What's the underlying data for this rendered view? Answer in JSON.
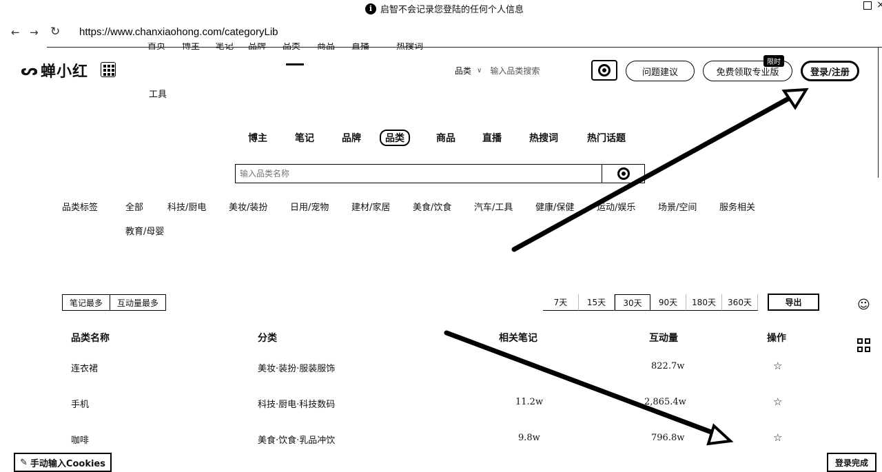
{
  "browser": {
    "banner_text": "启智不会记录您登陆的任何个人信息",
    "info_icon": "i",
    "back_glyph": "←",
    "forward_glyph": "→",
    "reload_glyph": "↻",
    "url": "https://www.chanxiaohong.com/categoryLib"
  },
  "site": {
    "top_nav_items": [
      "首页",
      "博主",
      "笔记",
      "品牌",
      "品类",
      "商品",
      "直播",
      "热搜词"
    ],
    "logo_mark": "ᔕ",
    "logo_text": "蝉小红",
    "tools_label": "工具",
    "header_search": {
      "scope": "品类",
      "chevron": "∨",
      "placeholder": "输入品类搜索"
    },
    "feedback_label": "问题建议",
    "pro_label": "免费领取专业版",
    "pro_badge": "限时",
    "login_label": "登录/注册"
  },
  "main_tabs": [
    {
      "label": "博主",
      "active": false
    },
    {
      "label": "笔记",
      "active": false
    },
    {
      "label": "品牌",
      "active": false
    },
    {
      "label": "品类",
      "active": true
    },
    {
      "label": "商品",
      "active": false
    },
    {
      "label": "直播",
      "active": false
    },
    {
      "label": "热搜词",
      "active": false
    },
    {
      "label": "热门话题",
      "active": false
    }
  ],
  "category_search": {
    "placeholder": "输入品类名称"
  },
  "category_tags": {
    "label": "品类标签",
    "items": [
      "全部",
      "科技/厨电",
      "美妆/装扮",
      "日用/宠物",
      "建材/家居",
      "美食/饮食",
      "汽车/工具",
      "健康/保健",
      "运动/娱乐",
      "场景/空间",
      "服务相关",
      "教育/母婴"
    ]
  },
  "sort_options": [
    "笔记最多",
    "互动量最多"
  ],
  "day_ranges": [
    "7天",
    "15天",
    "30天",
    "90天",
    "180天",
    "360天"
  ],
  "active_day_range": "30天",
  "export_label": "导出",
  "table": {
    "headers": [
      "品类名称",
      "分类",
      "相关笔记",
      "互动量",
      "操作"
    ],
    "rows": [
      {
        "name": "连衣裙",
        "category": "美妆·装扮·服装服饰",
        "notes": "",
        "interactions": "822.7w",
        "action": "☆"
      },
      {
        "name": "手机",
        "category": "科技·厨电·科技数码",
        "notes": "11.2w",
        "interactions": "2,865.4w",
        "action": "☆"
      },
      {
        "name": "咖啡",
        "category": "美食·饮食·乳品冲饮",
        "notes": "9.8w",
        "interactions": "796.8w",
        "action": "☆"
      }
    ]
  },
  "side_tools": {
    "service_icon": "☺"
  },
  "bottom": {
    "cookies_label": "手动输入Cookies",
    "done_label": "登录完成"
  }
}
